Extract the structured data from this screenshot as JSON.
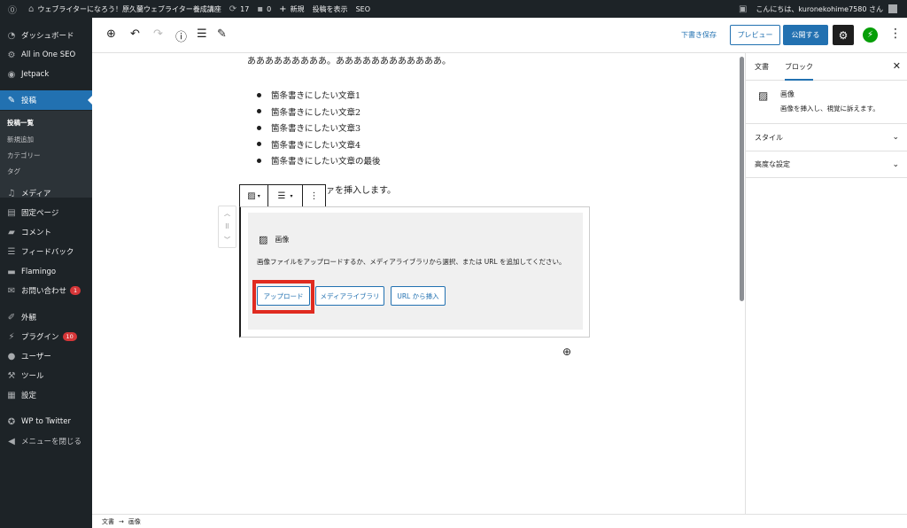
{
  "adminbar": {
    "wp_logo_icon": "wordpress-icon",
    "site_name": "ウェブライターになろう！原久蘭ウェブライター養成講座",
    "updates_count": "17",
    "comments_count": "0",
    "new_label": "新規",
    "view_post_label": "投稿を表示",
    "seo_label": "SEO",
    "greeting": "こんにちは、kuronekohime7580 さん"
  },
  "sidebar": {
    "items": [
      {
        "label": "ダッシュボード",
        "icon": "dashboard-icon"
      },
      {
        "label": "All in One SEO",
        "icon": "gear-icon"
      },
      {
        "label": "Jetpack",
        "icon": "jetpack-icon"
      },
      {
        "label": "投稿",
        "icon": "pushpin-icon"
      },
      {
        "label": "メディア",
        "icon": "media-icon"
      },
      {
        "label": "固定ページ",
        "icon": "page-icon"
      },
      {
        "label": "コメント",
        "icon": "comment-icon"
      },
      {
        "label": "フィードバック",
        "icon": "feedback-icon"
      },
      {
        "label": "Flamingo",
        "icon": "flamingo-icon"
      },
      {
        "label": "お問い合わせ",
        "icon": "mail-icon",
        "badge": "1"
      },
      {
        "label": "外観",
        "icon": "appearance-icon"
      },
      {
        "label": "プラグイン",
        "icon": "plugin-icon",
        "badge": "10"
      },
      {
        "label": "ユーザー",
        "icon": "user-icon"
      },
      {
        "label": "ツール",
        "icon": "wrench-icon"
      },
      {
        "label": "設定",
        "icon": "settings-icon"
      },
      {
        "label": "WP to Twitter",
        "icon": "twitter-icon"
      },
      {
        "label": "メニューを閉じる",
        "icon": "collapse-icon"
      }
    ],
    "submenu": [
      "投稿一覧",
      "新規追加",
      "カテゴリー",
      "タグ"
    ]
  },
  "toolbar": {
    "save_draft": "下書き保存",
    "preview": "プレビュー",
    "publish": "公開する"
  },
  "content": {
    "top_paragraph": "あああああああああ。ああああああああああああ。",
    "bullets": [
      "箇条書きにしたい文章1",
      "箇条書きにしたい文章2",
      "箇条書きにしたい文章3",
      "箇条書きにしたい文章4",
      "箇条書きにしたい文章の最後"
    ],
    "partial_paragraph": "ァを挿入します。",
    "image_block": {
      "title": "画像",
      "description": "画像ファイルをアップロードするか、メディアライブラリから選択、または URL を追加してください。",
      "upload": "アップロード",
      "media_library": "メディアライブラリ",
      "insert_url": "URL から挿入"
    }
  },
  "inspector": {
    "tab_document": "文書",
    "tab_block": "ブロック",
    "block_title": "画像",
    "block_desc": "画像を挿入し、視覚に訴えます。",
    "panel_styles": "スタイル",
    "panel_advanced": "高度な設定"
  },
  "footer": {
    "crumb_document": "文書",
    "arrow": "→",
    "crumb_image": "画像"
  },
  "colors": {
    "accent": "#2271b1",
    "highlight": "#e02b20",
    "admin_dark": "#1d2327"
  }
}
